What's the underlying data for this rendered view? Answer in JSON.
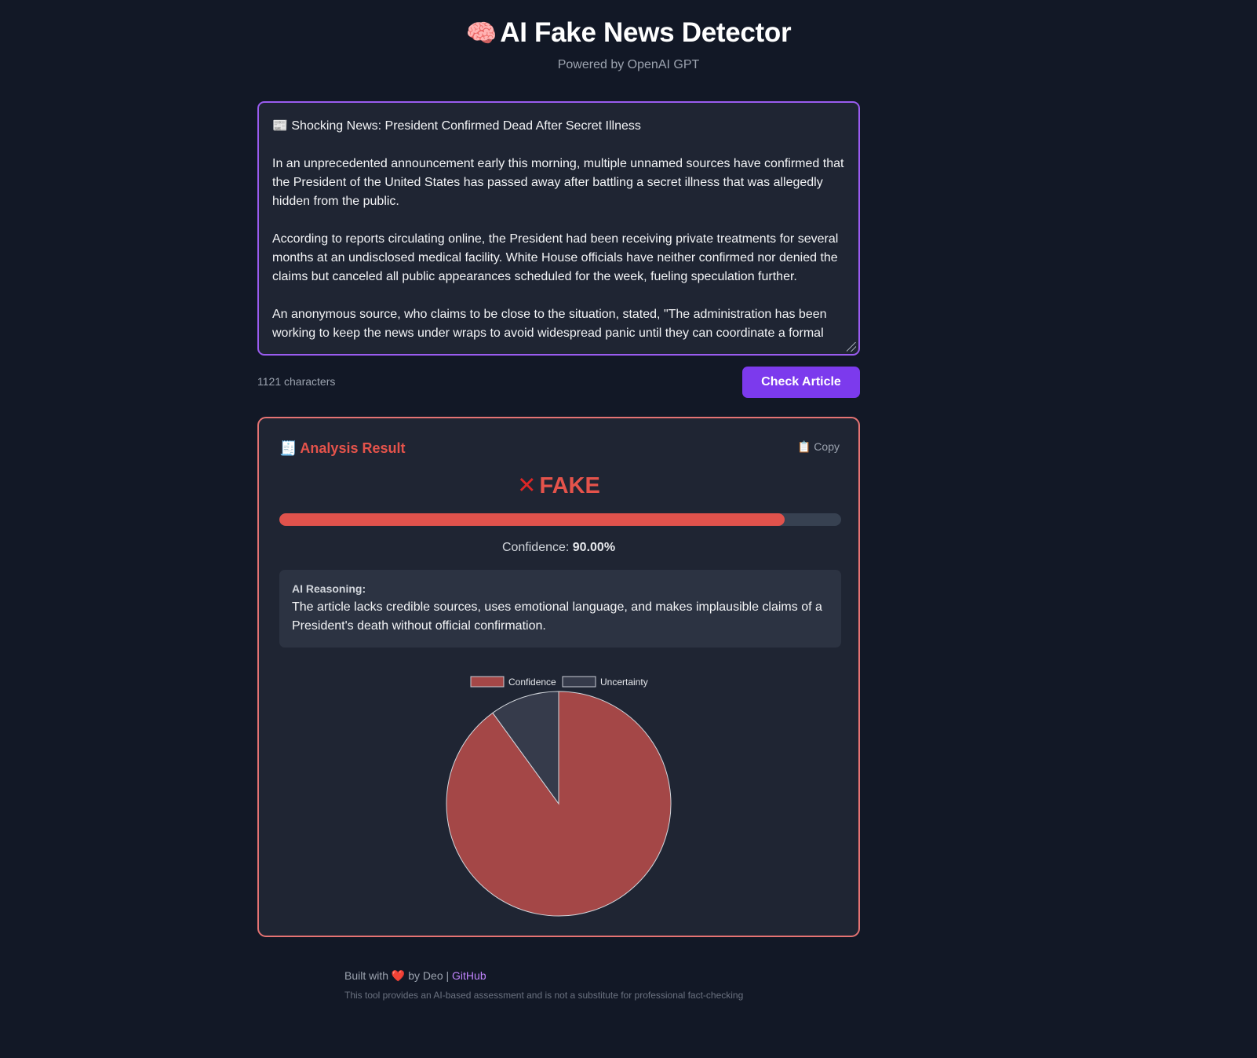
{
  "header": {
    "title_emoji": "🧠",
    "title": "AI Fake News Detector",
    "subtitle": "Powered by OpenAI GPT"
  },
  "article": {
    "text": "📰 Shocking News: President Confirmed Dead After Secret Illness\n\nIn an unprecedented announcement early this morning, multiple unnamed sources have confirmed that the President of the United States has passed away after battling a secret illness that was allegedly hidden from the public.\n\nAccording to reports circulating online, the President had been receiving private treatments for several months at an undisclosed medical facility. White House officials have neither confirmed nor denied the claims but canceled all public appearances scheduled for the week, fueling speculation further.\n\nAn anonymous source, who claims to be close to the situation, stated, \"The administration has been working to keep the news under wraps to avoid widespread panic until they can coordinate a formal"
  },
  "char_count": "1121 characters",
  "check_button": "Check Article",
  "result": {
    "header_emoji": "🧾",
    "header": "Analysis Result",
    "copy_label": "📋 Copy",
    "verdict_icon": "✕",
    "verdict": "FAKE",
    "confidence_label": "Confidence:",
    "confidence_value": "90.00%",
    "progress_fraction": 0.9,
    "reasoning_label": "AI Reasoning:",
    "reasoning_text": "The article lacks credible sources, uses emotional language, and makes implausible claims of a President's death without official confirmation."
  },
  "chart_data": {
    "type": "pie",
    "labels": [
      "Confidence",
      "Uncertainty"
    ],
    "values": [
      90,
      10
    ],
    "colors": [
      "#a44747",
      "#363b4b"
    ],
    "legend": "top"
  },
  "footer": {
    "built_with": "Built with",
    "heart": "❤️",
    "by": "by Deo |",
    "github_label": "GitHub",
    "disclaimer": "This tool provides an AI-based assessment and is not a substitute for professional fact-checking"
  },
  "colors": {
    "background": "#121826",
    "accent": "#7c3aed",
    "fake": "#e5534b"
  }
}
